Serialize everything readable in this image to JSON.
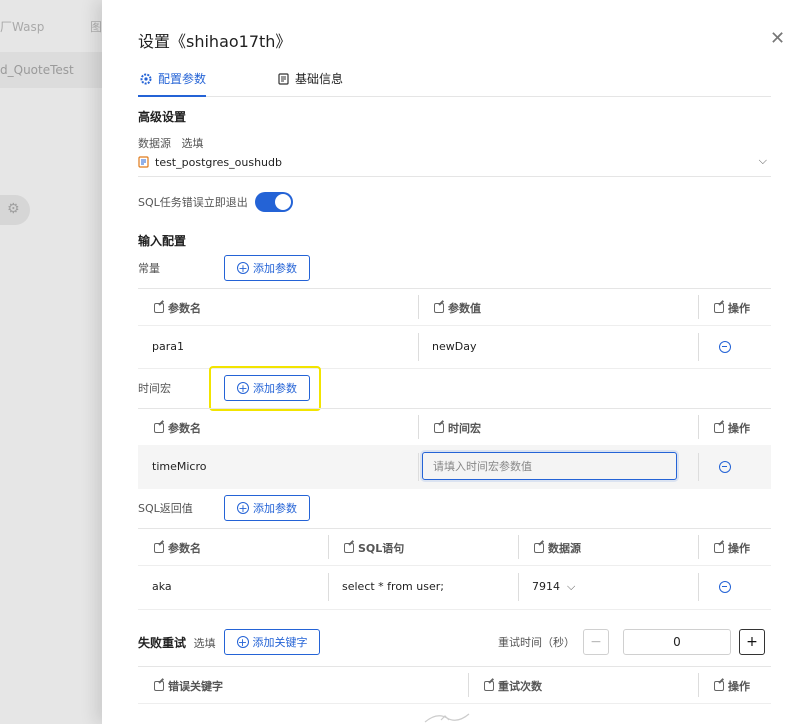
{
  "background": {
    "tab1": "厂Wasp",
    "tab2": "图",
    "row": "d_QuoteTest"
  },
  "drawer": {
    "title": "设置《shihao17th》"
  },
  "tabs": [
    {
      "label": "配置参数",
      "active": true
    },
    {
      "label": "基础信息",
      "active": false
    }
  ],
  "advanced": {
    "heading": "高级设置",
    "datasource_label": "数据源",
    "datasource_optional": "选填",
    "datasource_value": "test_postgres_oushudb",
    "sql_exit_label": "SQL任务错误立即退出",
    "sql_exit_on": true
  },
  "input": {
    "heading": "输入配置",
    "add_label": "添加参数",
    "constants": {
      "label": "常量",
      "columns": [
        "参数名",
        "参数值",
        "操作"
      ],
      "rows": [
        {
          "name": "para1",
          "value": "newDay"
        }
      ]
    },
    "time_macro": {
      "label": "时间宏",
      "columns": [
        "参数名",
        "时间宏",
        "操作"
      ],
      "rows": [
        {
          "name": "timeMicro",
          "placeholder": "请填入时间宏参数值"
        }
      ]
    },
    "sql_return": {
      "label": "SQL返回值",
      "columns": [
        "参数名",
        "SQL语句",
        "数据源",
        "操作"
      ],
      "rows": [
        {
          "name": "aka",
          "sql": "select * from user;",
          "datasource": "7914"
        }
      ]
    }
  },
  "retry": {
    "label": "失败重试",
    "optional": "选填",
    "add_keyword_label": "添加关键字",
    "time_label": "重试时间（秒）",
    "time_value": "0",
    "minus": "−",
    "plus": "+",
    "columns": [
      "错误关键字",
      "重试次数",
      "操作"
    ]
  },
  "colors": {
    "accent": "#2463d6",
    "highlight": "#f2e400"
  }
}
